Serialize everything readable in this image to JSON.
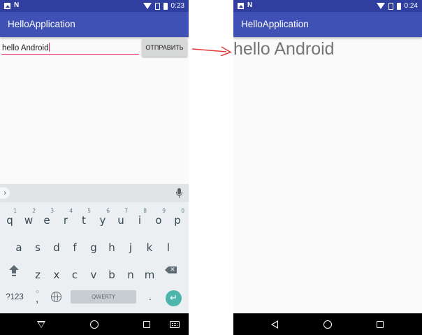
{
  "left_screen": {
    "status_bar": {
      "time": "0:23",
      "icons": [
        "image-icon",
        "n-icon",
        "wifi-icon",
        "no-sim-icon",
        "battery-icon"
      ]
    },
    "app_bar": {
      "title": "HelloApplication"
    },
    "edit_text": {
      "value": "hello Android"
    },
    "send_button": {
      "label": "ОТПРАВИТЬ"
    },
    "keyboard": {
      "row1": [
        {
          "key": "q",
          "hint": "1"
        },
        {
          "key": "w",
          "hint": "2"
        },
        {
          "key": "e",
          "hint": "3"
        },
        {
          "key": "r",
          "hint": "4"
        },
        {
          "key": "t",
          "hint": "5"
        },
        {
          "key": "y",
          "hint": "6"
        },
        {
          "key": "u",
          "hint": "7"
        },
        {
          "key": "i",
          "hint": "8"
        },
        {
          "key": "o",
          "hint": "9"
        },
        {
          "key": "p",
          "hint": "0"
        }
      ],
      "row2": [
        "a",
        "s",
        "d",
        "f",
        "g",
        "h",
        "j",
        "k",
        "l"
      ],
      "row3": [
        "z",
        "x",
        "c",
        "v",
        "b",
        "n",
        "m"
      ],
      "symbols_label": "?123",
      "comma": ",",
      "emoji_hint": "☺",
      "space_label": "QWERTY",
      "period": ".",
      "enter_glyph": "↵",
      "delete_glyph": "✕",
      "suggestion_chevron": "›"
    },
    "nav_bar": {
      "icons": [
        "back-icon",
        "home-icon",
        "recents-icon",
        "keyboard-switch-icon"
      ]
    }
  },
  "right_screen": {
    "status_bar": {
      "time": "0:24",
      "icons": [
        "image-icon",
        "n-icon",
        "wifi-icon",
        "no-sim-icon",
        "battery-icon"
      ]
    },
    "app_bar": {
      "title": "HelloApplication"
    },
    "message_text": "hello Android",
    "nav_bar": {
      "icons": [
        "back-icon",
        "home-icon",
        "recents-icon"
      ]
    }
  },
  "colors": {
    "status_bar": "#303f9f",
    "app_bar": "#3f51b5",
    "accent": "#e91e63",
    "enter_key": "#4db6ac",
    "arrow": "#e53935"
  }
}
